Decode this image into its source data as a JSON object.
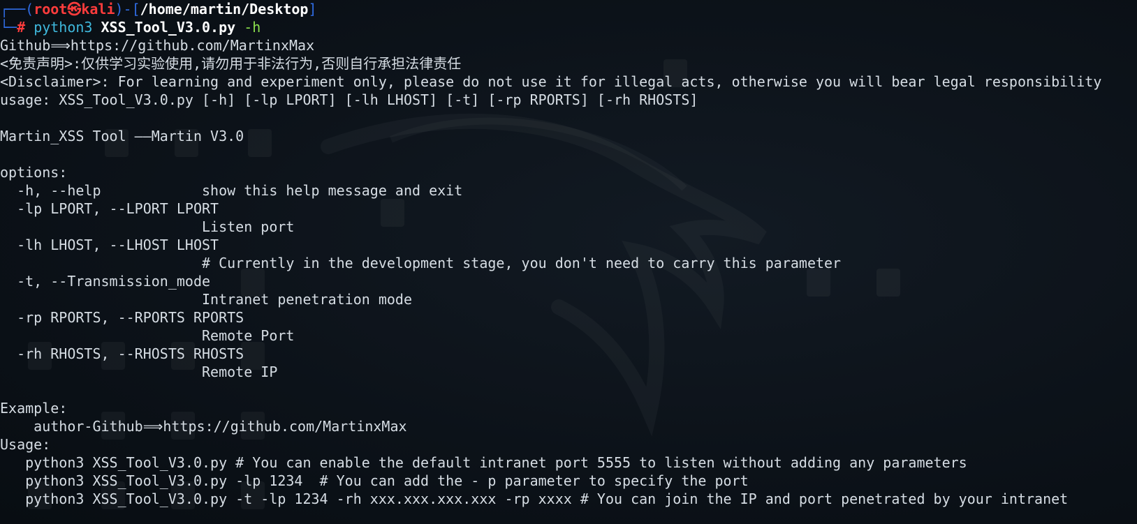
{
  "prompt": {
    "frame_top_left": "┌──(",
    "user": "root㉿kali",
    "frame_mid": ")-[",
    "path": "/home/martin/Desktop",
    "frame_end": "]",
    "frame_bottom_left": "└─",
    "symbol": "# ",
    "command": "python3 ",
    "script": "XSS_Tool_V3.0.py",
    "flag": " -h"
  },
  "output": {
    "github": "Github⟹https://github.com/MartinxMax",
    "disclaimer_cn": "<免责声明>:仅供学习实验使用,请勿用于非法行为,否则自行承担法律责任",
    "disclaimer_en": "<Disclaimer>: For learning and experiment only, please do not use it for illegal acts, otherwise you will bear legal responsibility",
    "usage": "usage: XSS_Tool_V3.0.py [-h] [-lp LPORT] [-lh LHOST] [-t] [-rp RPORTS] [-rh RHOSTS]",
    "title": "Martin_XSS Tool ——Martin V3.0",
    "options_header": "options:",
    "opt_help": "  -h, --help            show this help message and exit",
    "opt_lp": "  -lp LPORT, --LPORT LPORT",
    "opt_lp_desc": "                        Listen port",
    "opt_lh": "  -lh LHOST, --LHOST LHOST",
    "opt_lh_desc": "                        # Currently in the development stage, you don't need to carry this parameter",
    "opt_t": "  -t, --Transmission_mode",
    "opt_t_desc": "                        Intranet penetration mode",
    "opt_rp": "  -rp RPORTS, --RPORTS RPORTS",
    "opt_rp_desc": "                        Remote Port",
    "opt_rh": "  -rh RHOSTS, --RHOSTS RHOSTS",
    "opt_rh_desc": "                        Remote IP",
    "example_header": "Example:",
    "example_author": "    author-Github⟹https://github.com/MartinxMax",
    "usage_header": "Usage:",
    "usage_1": "   python3 XSS_Tool_V3.0.py # You can enable the default intranet port 5555 to listen without adding any parameters",
    "usage_2": "   python3 XSS_Tool_V3.0.py -lp 1234  # You can add the - p parameter to specify the port",
    "usage_3": "   python3 XSS_Tool_V3.0.py -t -lp 1234 -rh xxx.xxx.xxx.xxx -rp xxxx # You can join the IP and port penetrated by your intranet"
  },
  "colors": {
    "background": "#0b1118",
    "prompt_frame": "#2f6be1",
    "prompt_user": "#ff3c3c",
    "command": "#3fb8dc",
    "flag": "#8be04e",
    "text": "#d6dde4"
  }
}
